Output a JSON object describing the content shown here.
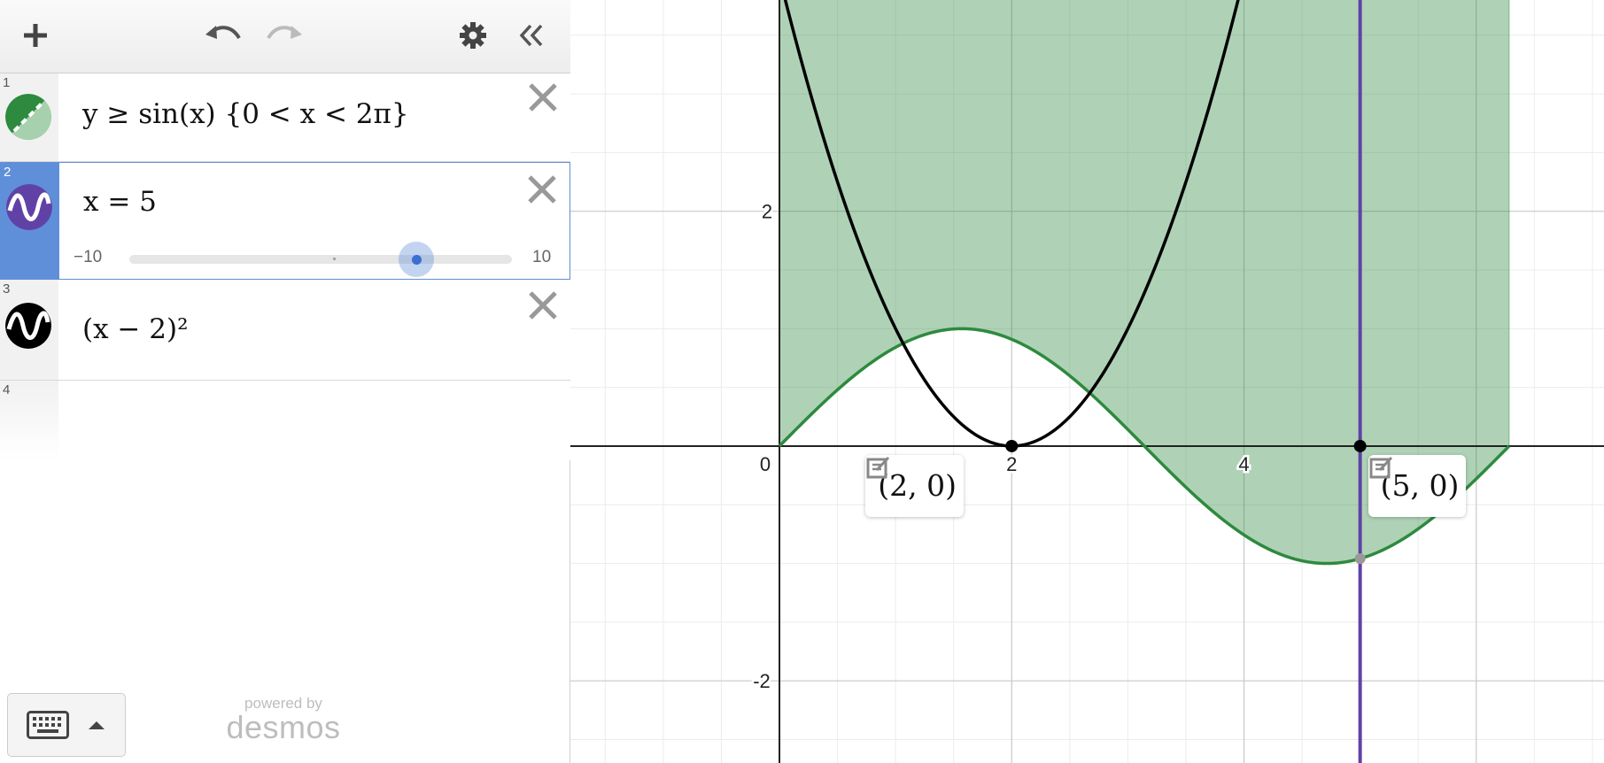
{
  "toolbar": {
    "add_icon": "plus-icon",
    "undo_icon": "undo-icon",
    "redo_icon": "redo-icon",
    "settings_icon": "gear-icon",
    "collapse_icon": "double-chevron-left-icon"
  },
  "expressions": [
    {
      "index": "1",
      "latex": "y ≥ sin(x) {0 < x < 2π}",
      "color": "#2d8a3e",
      "icon": "inequality-shading-icon"
    },
    {
      "index": "2",
      "latex": "x = 5",
      "color": "#6042a6",
      "icon": "wave-icon",
      "selected": true,
      "slider": {
        "min": "−10",
        "max": "10",
        "value": 5
      }
    },
    {
      "index": "3",
      "latex": "(x − 2)²",
      "color": "#000000",
      "icon": "wave-icon"
    },
    {
      "index": "4",
      "latex": ""
    }
  ],
  "footer": {
    "powered_by": "powered by",
    "brand": "desmos",
    "keyboard_icon": "keyboard-icon"
  },
  "graph": {
    "x_range": [
      -1.8,
      7.1
    ],
    "y_range": [
      -2.7,
      3.8
    ],
    "x_tick_labels": [
      "0",
      "2",
      "4"
    ],
    "y_tick_labels": [
      "2",
      "-2"
    ],
    "point_labels": [
      "(2, 0)",
      "(5, 0)"
    ],
    "colors": {
      "inequality": "#2d8a3e",
      "vertical_line": "#6042a6",
      "parabola": "#000000"
    }
  }
}
